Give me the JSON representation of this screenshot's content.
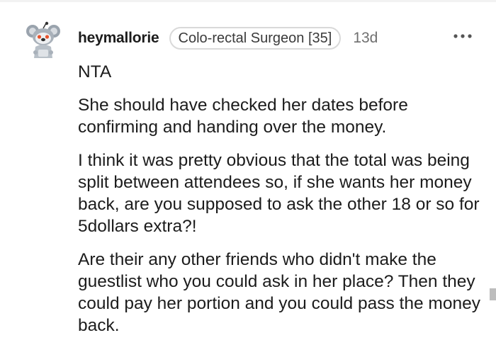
{
  "comment": {
    "username": "heymallorie",
    "flair": "Colo-rectal Surgeon [35]",
    "timestamp": "13d",
    "verdict": "NTA",
    "paragraphs": [
      "She should have checked her dates before confirming and handing over the money.",
      "I think it was pretty obvious that the total was being split between attendees so, if she wants her money back, are you supposed to ask the other 18 or so for 5dollars extra?!",
      "Are their any other friends who didn't make the guestlist who you could ask in her place? Then they could pay her portion and you could pass the money back."
    ]
  },
  "icons": {
    "avatar": "koala-snoo-avatar",
    "more": "more-options-icon"
  },
  "colors": {
    "text": "#1c1c1c",
    "muted": "#6f6f6f",
    "flair_border": "#d9d9d9",
    "background": "#ffffff"
  }
}
